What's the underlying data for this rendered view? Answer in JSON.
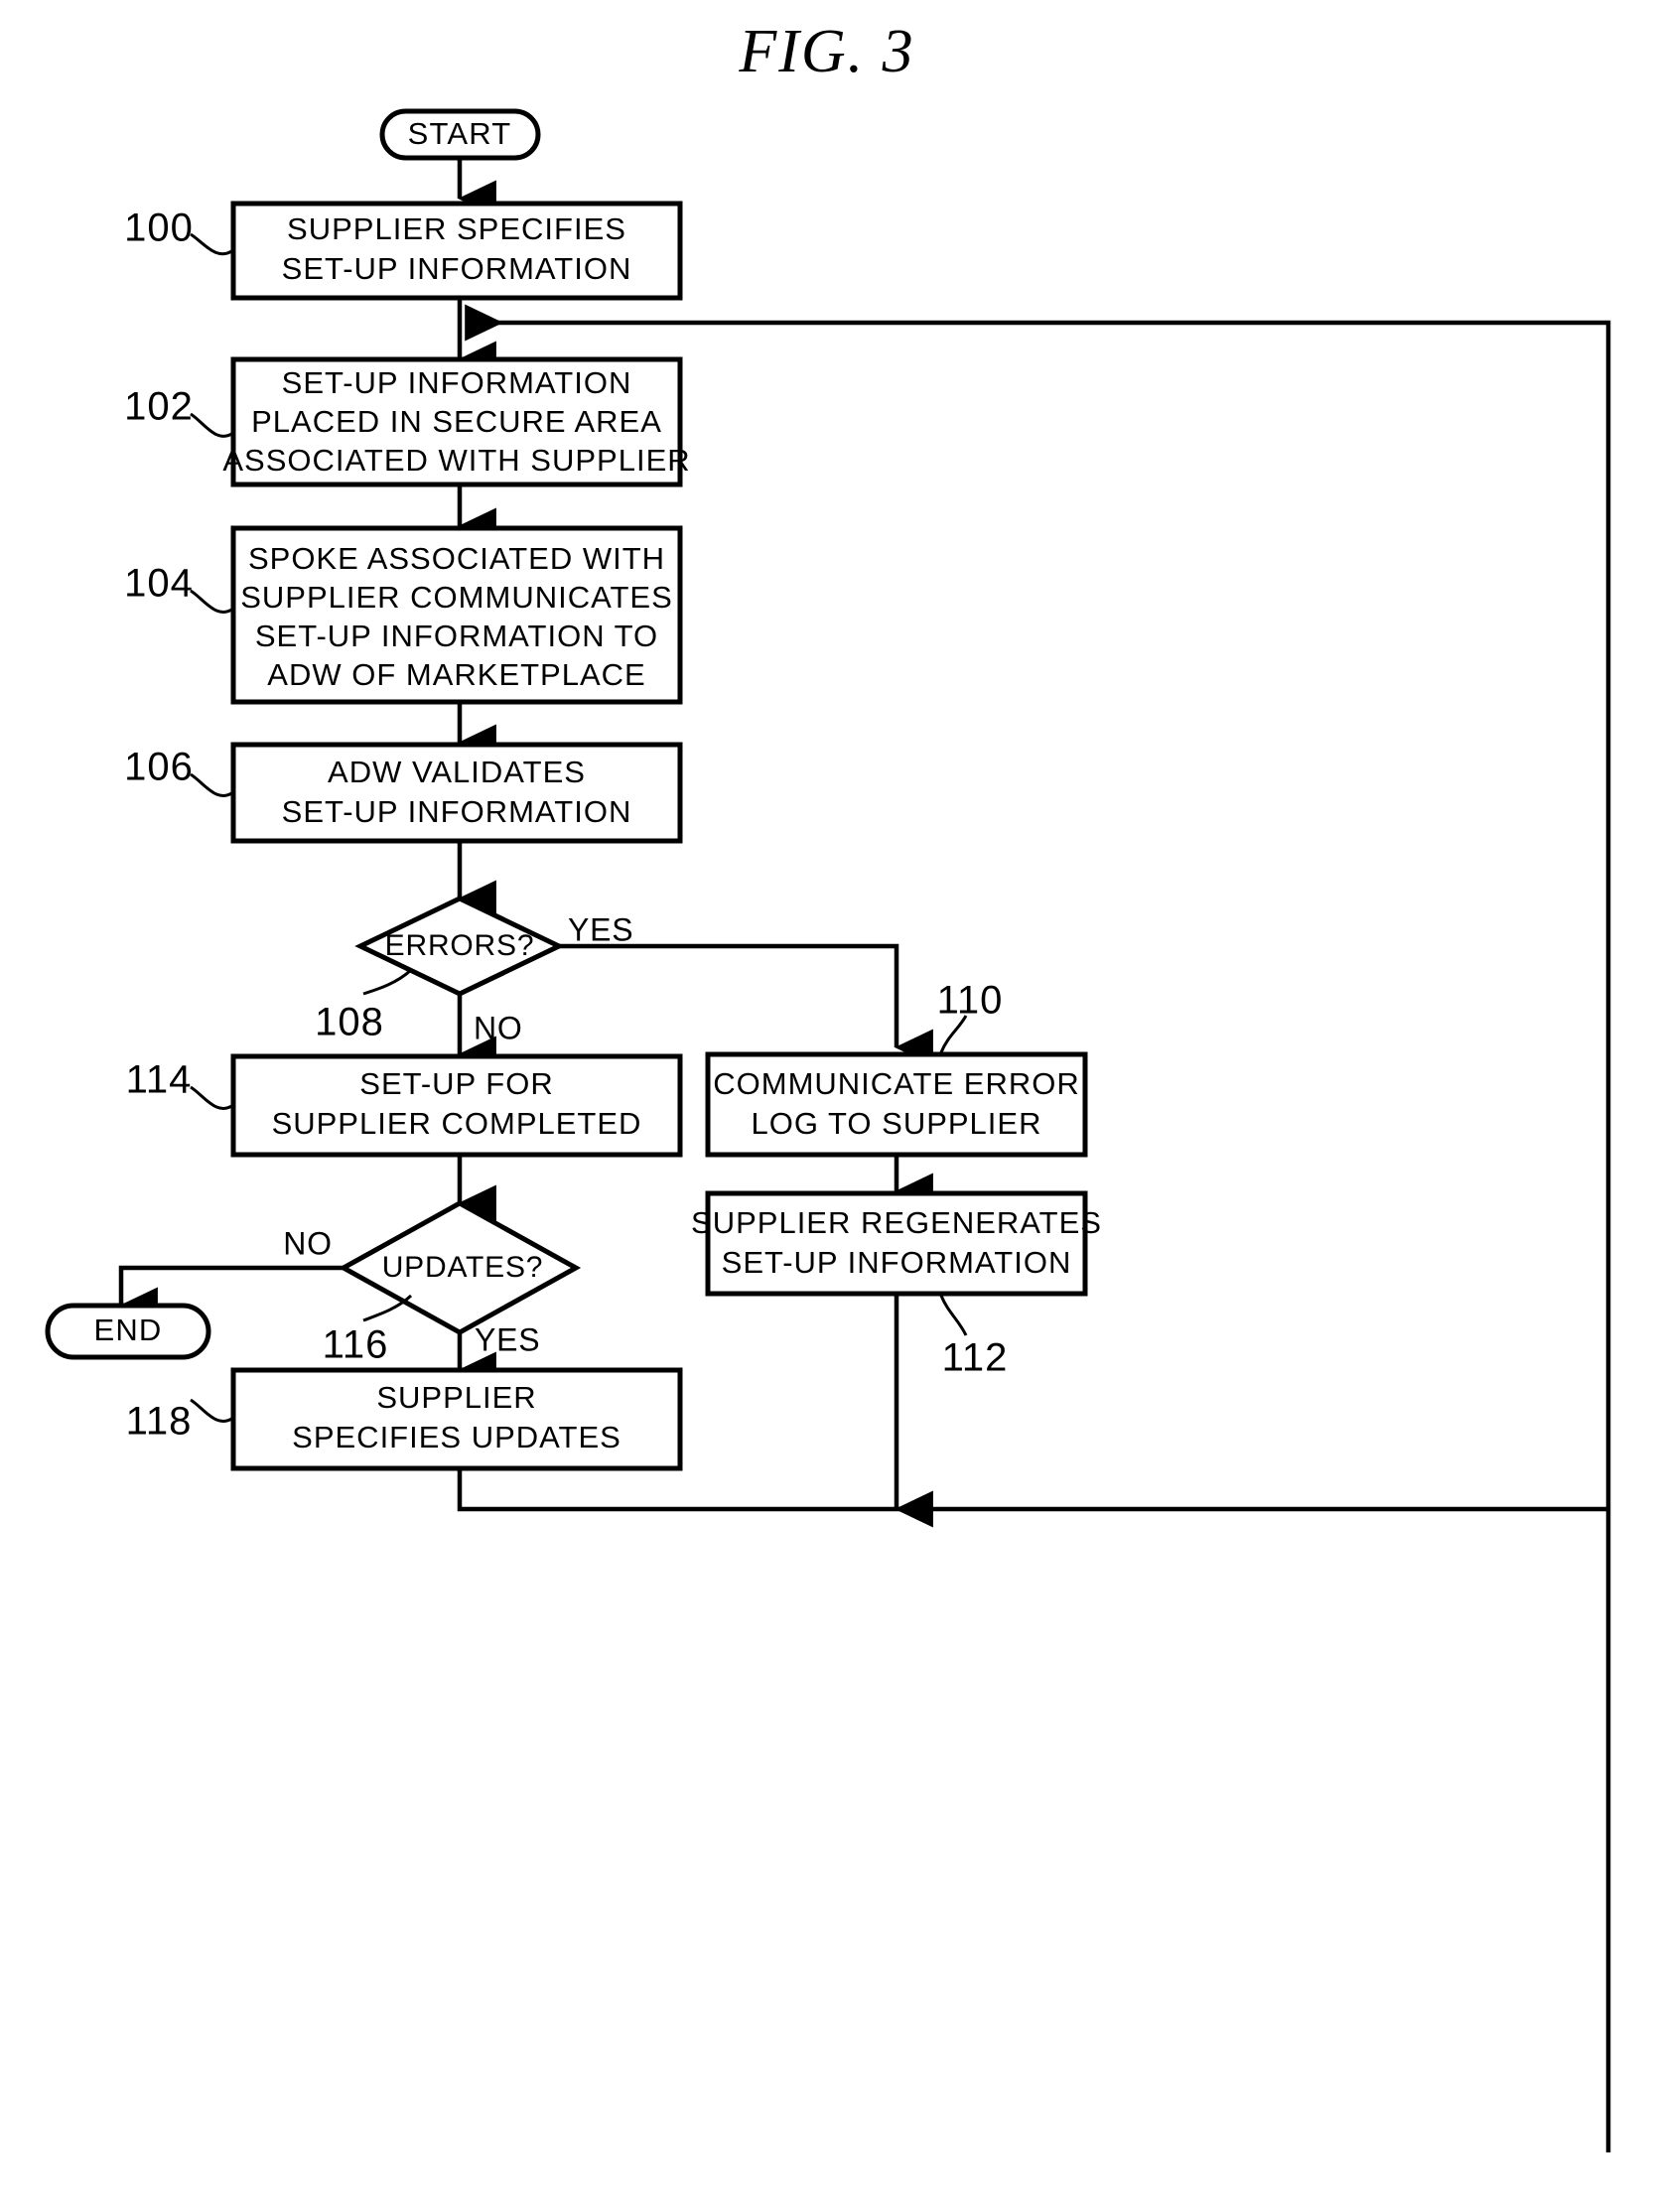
{
  "figure": {
    "title": "FIG.  3",
    "ink_color": "#000000",
    "background_color": "#ffffff"
  },
  "terminators": {
    "start": {
      "label": "START",
      "ref": ""
    },
    "end": {
      "label": "END",
      "ref": ""
    }
  },
  "nodes": [
    {
      "ref": "100",
      "shape": "process",
      "lines": [
        "SUPPLIER SPECIFIES",
        "SET-UP INFORMATION"
      ]
    },
    {
      "ref": "102",
      "shape": "process",
      "lines": [
        "SET-UP INFORMATION",
        "PLACED IN SECURE AREA",
        "ASSOCIATED WITH SUPPLIER"
      ]
    },
    {
      "ref": "104",
      "shape": "process",
      "lines": [
        "SPOKE ASSOCIATED WITH",
        "SUPPLIER COMMUNICATES",
        "SET-UP INFORMATION TO",
        "ADW OF MARKETPLACE"
      ]
    },
    {
      "ref": "106",
      "shape": "process",
      "lines": [
        "ADW VALIDATES",
        "SET-UP INFORMATION"
      ]
    },
    {
      "ref": "108",
      "shape": "decision",
      "lines": [
        "ERRORS?"
      ]
    },
    {
      "ref": "110",
      "shape": "process",
      "lines": [
        "COMMUNICATE ERROR",
        "LOG TO SUPPLIER"
      ]
    },
    {
      "ref": "112",
      "shape": "process",
      "lines": [
        "SUPPLIER REGENERATES",
        "SET-UP INFORMATION"
      ]
    },
    {
      "ref": "114",
      "shape": "process",
      "lines": [
        "SET-UP FOR",
        "SUPPLIER COMPLETED"
      ]
    },
    {
      "ref": "116",
      "shape": "decision",
      "lines": [
        "UPDATES?"
      ]
    },
    {
      "ref": "118",
      "shape": "process",
      "lines": [
        "SUPPLIER",
        "SPECIFIES UPDATES"
      ]
    }
  ],
  "edge_labels": {
    "errors_yes": "YES",
    "errors_no": "NO",
    "updates_no": "NO",
    "updates_yes": "YES"
  }
}
